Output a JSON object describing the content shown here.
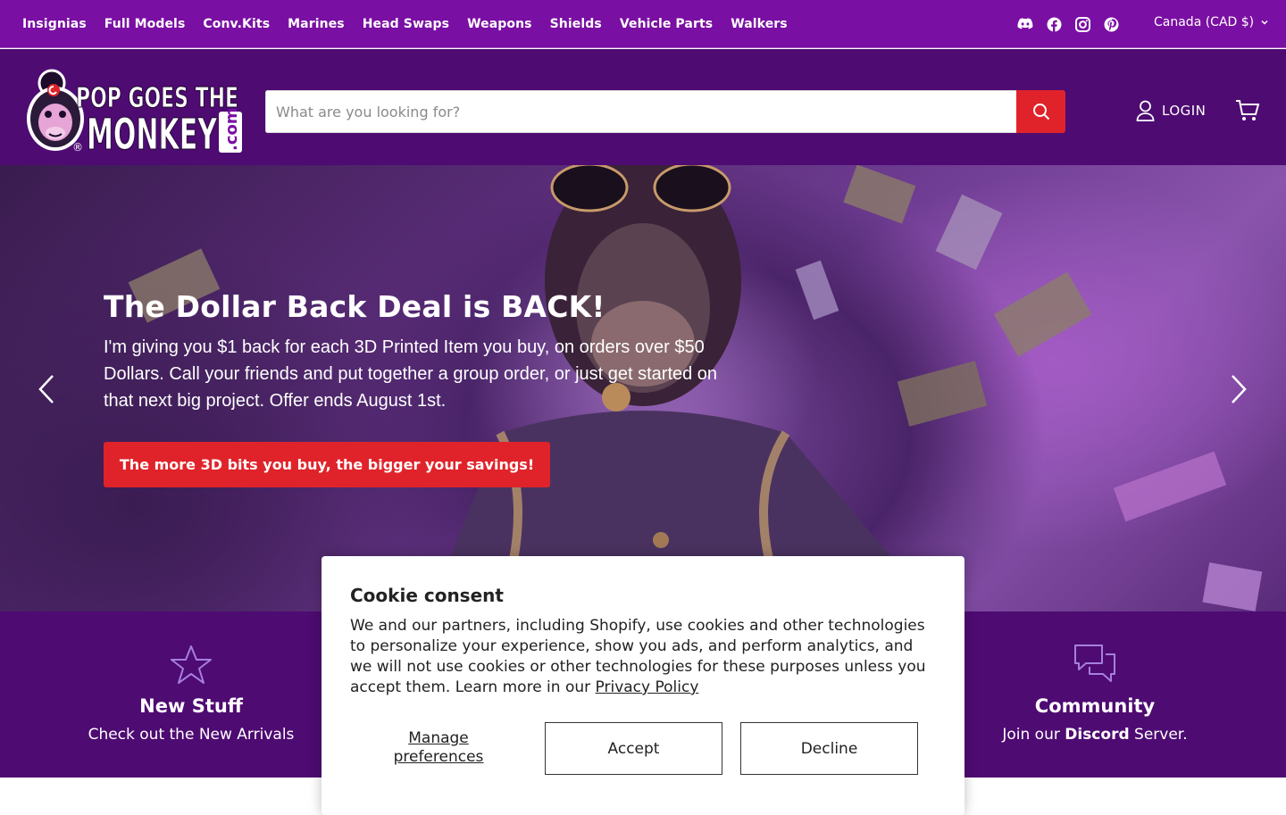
{
  "topnav": {
    "items": [
      {
        "label": "Insignias"
      },
      {
        "label": "Full Models"
      },
      {
        "label": "Conv.Kits"
      },
      {
        "label": "Marines"
      },
      {
        "label": "Head Swaps"
      },
      {
        "label": "Weapons"
      },
      {
        "label": "Shields"
      },
      {
        "label": "Vehicle Parts"
      },
      {
        "label": "Walkers"
      }
    ],
    "socials": [
      "discord-icon",
      "facebook-icon",
      "instagram-icon",
      "pinterest-icon"
    ],
    "currency": "Canada (CAD $)"
  },
  "header": {
    "logo_text_line1": "POP GOES THE",
    "logo_text_line2": "MONKEY",
    "logo_text_com": ".com",
    "search_placeholder": "What are you looking for?",
    "login_label": "LOGIN"
  },
  "hero": {
    "title": "The Dollar Back Deal is BACK!",
    "text": "I'm giving you $1 back for each 3D Printed Item you buy, on orders over $50 Dollars. Call your friends and put together a group order, or just get started on that next big project. Offer ends August 1st.",
    "button": "The more 3D bits you buy, the bigger your savings!"
  },
  "features": {
    "new": {
      "title": "New Stuff",
      "sub": "Check out the New Arrivals"
    },
    "community": {
      "title": "Community",
      "sub_prefix": "Join our ",
      "sub_bold": "Discord",
      "sub_suffix": " Server."
    }
  },
  "cookie": {
    "title": "Cookie consent",
    "body": "We and our partners, including Shopify, use cookies and other technologies to personalize your experience, show you ads, and perform analytics, and we will not use cookies or other technologies for these purposes unless you accept them. Learn more in our ",
    "link": "Privacy Policy",
    "manage": "Manage preferences",
    "accept": "Accept",
    "decline": "Decline"
  },
  "colors": {
    "topbar": "#7a0fa3",
    "header": "#4e0b72",
    "accent_red": "#e0232a"
  }
}
